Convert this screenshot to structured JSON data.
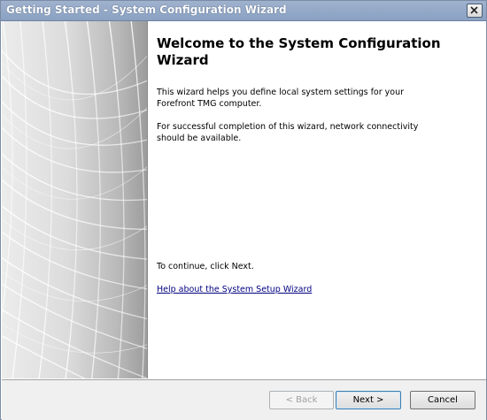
{
  "window": {
    "title": "Getting Started - System Configuration Wizard"
  },
  "content": {
    "heading": "Welcome to the System Configuration Wizard",
    "paragraph1": "This wizard helps you define local system settings for your Forefront TMG computer.",
    "paragraph2": "For successful completion of this wizard, network connectivity should be available.",
    "continue_text": "To continue, click Next.",
    "help_link": "Help about the System Setup Wizard"
  },
  "buttons": {
    "back": "< Back",
    "next": "Next >",
    "cancel": "Cancel"
  },
  "icons": {
    "close": "close-icon"
  },
  "colors": {
    "titlebar": "#8aa1c2",
    "link": "#000080",
    "footer": "#f0f0f0"
  }
}
